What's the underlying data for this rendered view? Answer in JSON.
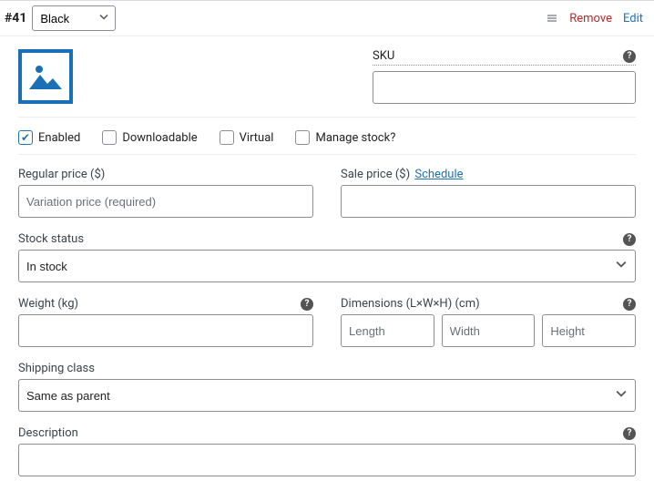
{
  "header": {
    "id_prefix": "#41",
    "attribute_value": "Black",
    "remove_label": "Remove",
    "edit_label": "Edit"
  },
  "sku": {
    "label": "SKU",
    "value": ""
  },
  "checks": {
    "enabled": {
      "label": "Enabled",
      "checked": true
    },
    "downloadable": {
      "label": "Downloadable",
      "checked": false
    },
    "virtual": {
      "label": "Virtual",
      "checked": false
    },
    "manage_stock": {
      "label": "Manage stock?",
      "checked": false
    }
  },
  "regular_price": {
    "label": "Regular price ($)",
    "placeholder": "Variation price (required)",
    "value": ""
  },
  "sale_price": {
    "label": "Sale price ($)",
    "schedule_link": "Schedule",
    "value": ""
  },
  "stock_status": {
    "label": "Stock status",
    "value": "In stock"
  },
  "weight": {
    "label": "Weight (kg)",
    "value": ""
  },
  "dimensions": {
    "label": "Dimensions (L×W×H) (cm)",
    "length_placeholder": "Length",
    "width_placeholder": "Width",
    "height_placeholder": "Height",
    "length": "",
    "width": "",
    "height": ""
  },
  "shipping_class": {
    "label": "Shipping class",
    "value": "Same as parent"
  },
  "description": {
    "label": "Description"
  }
}
